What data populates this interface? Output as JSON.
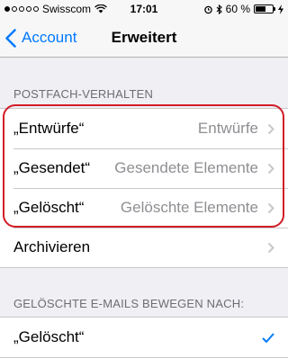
{
  "status_bar": {
    "carrier": "Swisscom",
    "time": "17:01",
    "battery": "60 %",
    "battery_level": 0.6
  },
  "nav": {
    "back_label": "Account",
    "title": "Erweitert"
  },
  "mailbox_behavior": {
    "header": "POSTFACH-VERHALTEN",
    "rows": [
      {
        "label": "„Entwürfe“",
        "value": "Entwürfe"
      },
      {
        "label": "„Gesendet“",
        "value": "Gesendete Elemente"
      },
      {
        "label": "„Gelöscht“",
        "value": "Gelöschte Elemente"
      },
      {
        "label": "Archivieren",
        "value": ""
      }
    ]
  },
  "move_deleted": {
    "header": "GELÖSCHTE E-MAILS BEWEGEN NACH:",
    "rows": [
      {
        "label": "„Gelöscht“",
        "selected": true
      }
    ]
  },
  "colors": {
    "accent": "#007aff",
    "highlight": "#d21c27"
  }
}
